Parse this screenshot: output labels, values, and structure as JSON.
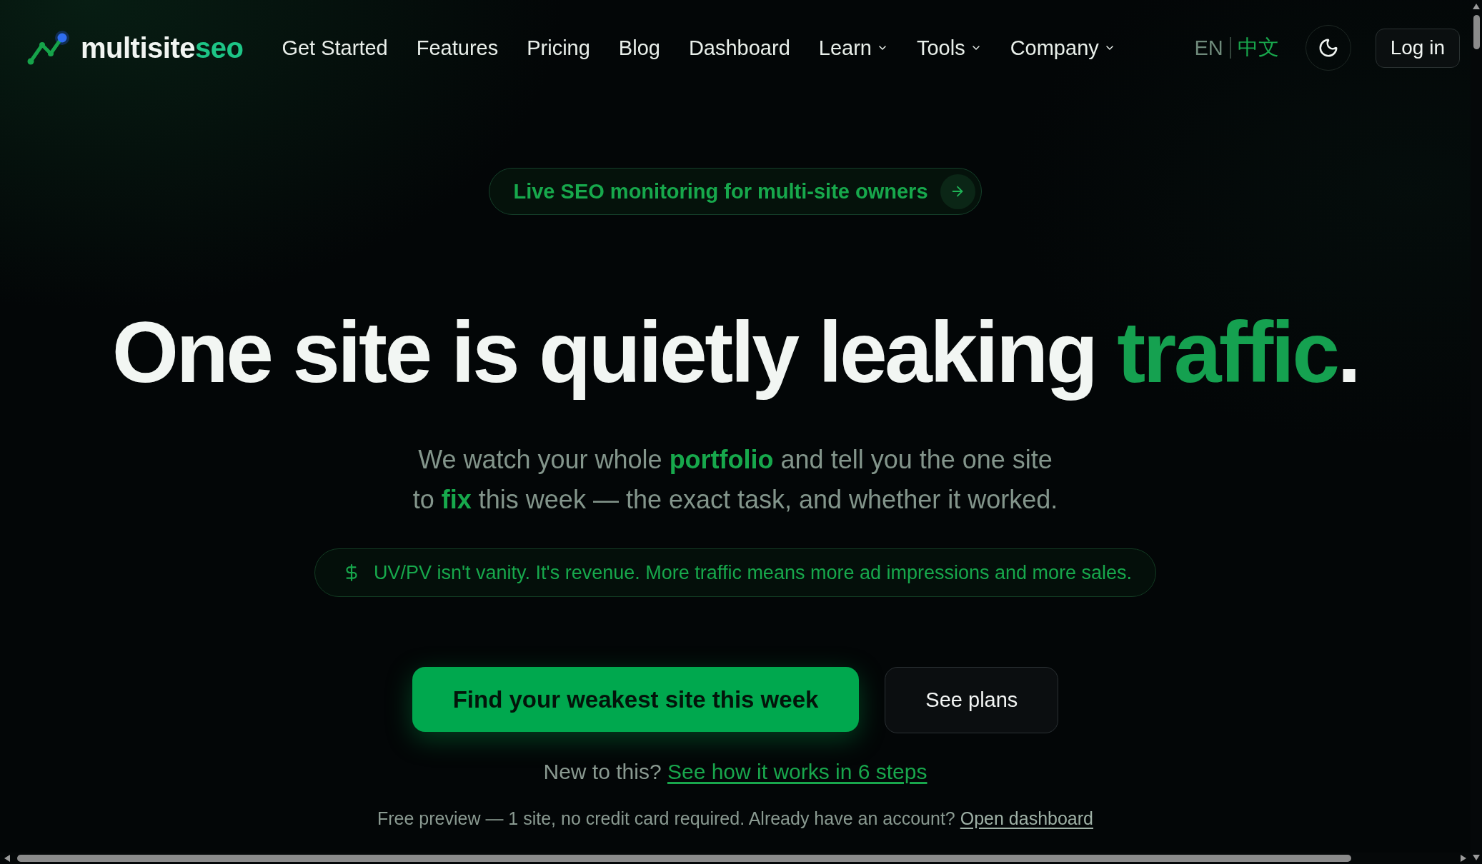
{
  "header": {
    "logo": {
      "text": "multisite",
      "accent": "seo"
    },
    "nav": [
      {
        "label": "Get Started",
        "kind": "link"
      },
      {
        "label": "Features",
        "kind": "link"
      },
      {
        "label": "Pricing",
        "kind": "link"
      },
      {
        "label": "Blog",
        "kind": "link"
      },
      {
        "label": "Dashboard",
        "kind": "link"
      },
      {
        "label": "Learn",
        "kind": "menu"
      },
      {
        "label": "Tools",
        "kind": "menu"
      },
      {
        "label": "Company",
        "kind": "menu"
      }
    ],
    "languages": [
      {
        "label": "EN",
        "selected": false
      },
      {
        "label": "中文",
        "selected": true
      }
    ],
    "login_button": "Log in"
  },
  "hero": {
    "badge": "Live SEO monitoring for multi-site owners",
    "headline": [
      {
        "text": "One site is quietly leaking ",
        "accent": false
      },
      {
        "text": "traffic",
        "accent": true
      },
      {
        "text": ".",
        "accent": false
      }
    ],
    "subtitle": "We watch your whole **portfolio** and tell you the one site to **fix** this week — the exact task, and whether it worked.",
    "revenue_note": "UV/PV isn't vanity. It's revenue. More traffic means more ad impressions and more sales.",
    "buttons": [
      {
        "label": "Find your weakest site this week",
        "kind": "primary"
      },
      {
        "label": "See plans",
        "kind": "secondary"
      }
    ],
    "intro_note": {
      "text": "New to this?",
      "link": "See how it works in 6 steps"
    },
    "account_note": {
      "text": "Free preview — 1 site, no credit card required. Already have an account?",
      "link": "Open dashboard"
    }
  }
}
